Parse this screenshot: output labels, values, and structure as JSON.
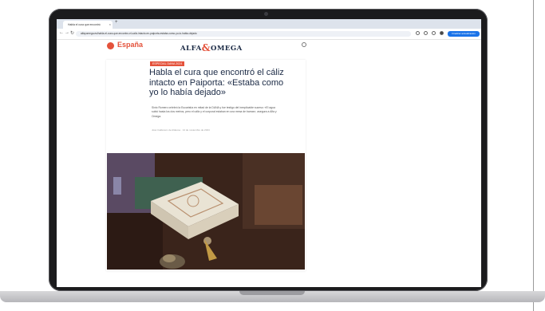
{
  "browser": {
    "tab_title": "Habla el cura que encontró",
    "tab_close": "×",
    "new_tab": "+",
    "url": "alfayomega.es/habla-el-cura-que-encontro-el-caliz-intacto-en-paiporta-estaba-como-yo-lo-habia-dejado",
    "back": "←",
    "forward": "→",
    "reload": "↻",
    "profile_label": "Finalizar actualización"
  },
  "site": {
    "section": "España",
    "logo_left": "ALFA",
    "logo_amp": "&",
    "logo_right": "OMEGA"
  },
  "article": {
    "kicker": "ESPECIAL DANA 2024",
    "headline": "Habla el cura que encontró el cáliz intacto en Paiporta: «Estaba como yo lo había dejado»",
    "lede": "Sixto Romero celebró la Eucaristía en mitad de la DANA y fue testigo del inexplicable suceso: «El agua subió hasta los dos metros, pero el cáliz y el corporal estaban en una mesa de barras», asegura a Alfa y Omega.",
    "byline": "José Calderero de Aldecoa · 14 de noviembre de 2024"
  },
  "colors": {
    "accent": "#e4523b",
    "navy": "#1b2a45"
  }
}
